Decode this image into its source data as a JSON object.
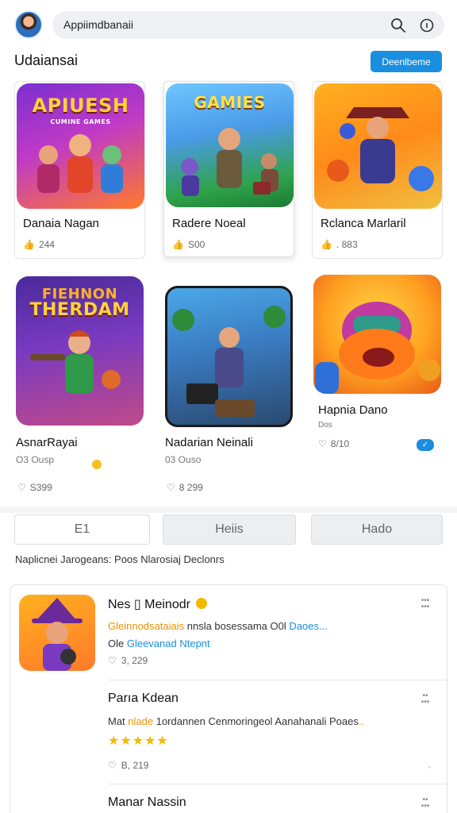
{
  "header": {
    "search_text": "Appiimdbanaii"
  },
  "section": {
    "title": "Udaiansai",
    "download_label": "Deenlbeme"
  },
  "grid": [
    {
      "art_title": "APIUESH",
      "art_sub": "CUMINE GAMES",
      "name": "Danaia Nagan",
      "likes": "244"
    },
    {
      "art_title": "GAMIES",
      "name": "Radere Noeal",
      "likes": "S00"
    },
    {
      "art_title": "",
      "name": "Rclanca Marlaril",
      "likes": ". 883"
    },
    {
      "art_title": "FIEHNON",
      "art_sub": "THERDAM",
      "name": "AsnarRayai",
      "sub": "O3 Ousp",
      "likes": "S399"
    },
    {
      "art_title": "",
      "name": "Nadarian Neinali",
      "sub": "03 Ouso",
      "likes": "8 299"
    },
    {
      "art_title": "",
      "name": "Hapnia Dano",
      "sub": "Dos",
      "likes": "8/10"
    }
  ],
  "tabs": [
    "E1",
    "Heiis",
    "Hado"
  ],
  "subtitle": "Naplicnei Jarogeans: Poos Nlarosiaj Declonrs",
  "list": [
    {
      "title": "Nes ▯ Meinodr",
      "desc_highlight": "Gleinnodsataiais",
      "desc_rest": " nnsla bosessama O0l ",
      "desc_tail": "Daoes...",
      "desc2_prefix": "Ole ",
      "desc2_link": "Gleevanad Ntepnt",
      "likes": "3, 229",
      "more": "••• \n•••"
    },
    {
      "title": "Parıa Kdean",
      "desc_prefix": "Mat ",
      "desc_highlight": "nlade",
      "desc_rest": " 1ordannen Cenmoringeol Aanahanali Poaes",
      "desc_tail": "..",
      "likes": "B, 219",
      "stars": "★★★★★",
      "more": "••\n•••"
    },
    {
      "title": "Manar Nassin",
      "more": "•• \n•••"
    }
  ]
}
